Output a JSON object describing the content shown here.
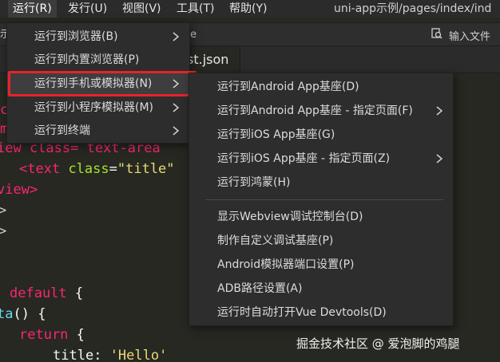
{
  "menubar": {
    "items": [
      "运行(R)",
      "发行(U)",
      "视图(V)",
      "工具(T)",
      "帮助(Y)"
    ],
    "title": "uni-app示例/pages/index/ind"
  },
  "toolbar": {
    "left_text": "示",
    "e_text": "e",
    "search_placeholder": "输入文件"
  },
  "tab": {
    "label": "st.json"
  },
  "code": {
    "line_c": "c",
    "line_m": "m",
    "line1": "iew class= text-area",
    "line2_tag_open": "<text",
    "line2_attr": "class",
    "line2_eq": "=",
    "line2_val": "\"title\"",
    "line2_close": ">",
    "line3": "view>",
    "line4": ">",
    "line5": ">",
    "line6_kw": "default",
    "line6_rest": "{",
    "line7_fn": "ta",
    "line7_rest": "() {",
    "line8_kw": "return",
    "line8_rest": "{",
    "line9_key": "title",
    "line9_colon": ":",
    "line9_val": "'Hello'"
  },
  "run_menu": {
    "items": [
      {
        "label": "运行到浏览器(B)"
      },
      {
        "label": "运行到内置浏览器(P)"
      },
      {
        "label": "运行到手机或模拟器(N)"
      },
      {
        "label": "运行到小程序模拟器(M)"
      },
      {
        "label": "运行到终端"
      }
    ]
  },
  "device_menu": {
    "items": [
      {
        "label": "运行到Android App基座(D)"
      },
      {
        "label": "运行到Android App基座 - 指定页面(F)"
      },
      {
        "label": "运行到iOS App基座(G)"
      },
      {
        "label": "运行到iOS App基座 - 指定页面(Z)"
      },
      {
        "label": "运行到鸿蒙(H)"
      },
      {
        "label": "显示Webview调试控制台(D)"
      },
      {
        "label": "制作自定义调试基座(P)"
      },
      {
        "label": "Android模拟器端口设置(P)"
      },
      {
        "label": "ADB路径设置(A)"
      },
      {
        "label": "运行时自动打开Vue Devtools(D)"
      }
    ]
  },
  "colors": {
    "highlight_box": "#e8232a",
    "menu_bg": "#2d2d2d",
    "editor_bg": "#272822"
  },
  "watermark": "掘金技术社区 @ 爱泡脚的鸡腿"
}
